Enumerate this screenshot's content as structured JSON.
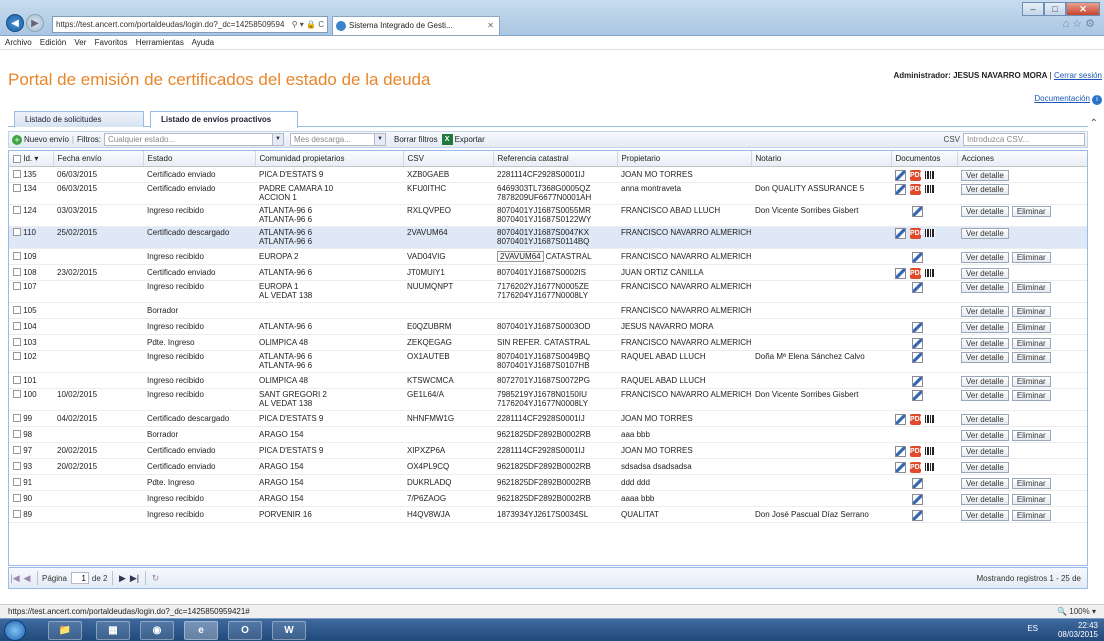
{
  "browser": {
    "url": "https://test.ancert.com/portaldeudas/login.do?_dc=1425850959421",
    "url_shown": "https://test.ancert.com/portaldeudas/login.do?_dc=14258509594",
    "tab_title": "Sistema Integrado de Gesti...",
    "menu": [
      "Archivo",
      "Edición",
      "Ver",
      "Favoritos",
      "Herramientas",
      "Ayuda"
    ]
  },
  "header": {
    "title": "Portal de emisión de certificados del estado de la deuda",
    "admin_label": "Administrador:",
    "admin_name": "JESUS NAVARRO MORA",
    "logout": "Cerrar sesión",
    "documentation": "Documentación"
  },
  "tabs": [
    {
      "label": "Listado de solicitudes",
      "active": false
    },
    {
      "label": "Listado de envíos proactivos",
      "active": true
    }
  ],
  "toolbar": {
    "new_label": "Nuevo envío",
    "filters_label": "Filtros:",
    "status_placeholder": "Cualquier estado...",
    "month_placeholder": "Mes descarga...",
    "clear_filters": "Borrar filtros",
    "export": "Exportar",
    "csv_label": "CSV",
    "csv_placeholder": "Introduzca CSV..."
  },
  "columns": [
    "Id.",
    "Fecha envío",
    "Estado",
    "Comunidad propietarios",
    "CSV",
    "Referencia catastral",
    "Propietario",
    "Notario",
    "Documentos",
    "Acciones"
  ],
  "action_labels": {
    "view": "Ver detalle",
    "delete": "Eliminar"
  },
  "tooltip": "2VAVUM64",
  "rows": [
    {
      "id": "135",
      "fecha": "06/03/2015",
      "estado": "Certificado enviado",
      "comunidad": [
        "PICA D'ESTATS 9"
      ],
      "csv": "XZB0GAEB",
      "ref": [
        "2281114CF2928S0001IJ"
      ],
      "propietario": "JOAN MO TORRES",
      "notario": "",
      "docs": [
        "edit",
        "pdf",
        "bar"
      ],
      "delete": false
    },
    {
      "id": "134",
      "fecha": "06/03/2015",
      "estado": "Certificado enviado",
      "comunidad": [
        "PADRE CAMARA 10",
        "ACCION 1"
      ],
      "csv": "KFU0ITHC",
      "ref": [
        "6469303TL7368G0005QZ",
        "7878209UF6677N0001AH"
      ],
      "propietario": "anna montraveta",
      "notario": "Don QUALITY ASSURANCE 5",
      "docs": [
        "edit",
        "pdf",
        "bar"
      ],
      "delete": false
    },
    {
      "id": "124",
      "fecha": "03/03/2015",
      "estado": "Ingreso recibido",
      "comunidad": [
        "ATLANTA-96 6",
        "ATLANTA-96 6"
      ],
      "csv": "RXLQVPEO",
      "ref": [
        "8070401YJ1687S0055MR",
        "8070401YJ1687S0122WY"
      ],
      "propietario": "FRANCISCO ABAD LLUCH",
      "notario": "Don Vicente Sorribes Gisbert",
      "docs": [
        "edit"
      ],
      "delete": true
    },
    {
      "id": "110",
      "fecha": "25/02/2015",
      "estado": "Certificado descargado",
      "comunidad": [
        "ATLANTA-96 6",
        "ATLANTA-96 6"
      ],
      "csv": "2VAVUM64",
      "ref": [
        "8070401YJ1687S0047KX",
        "8070401YJ1687S0114BQ"
      ],
      "propietario": "FRANCISCO NAVARRO ALMERICH",
      "notario": "",
      "docs": [
        "edit",
        "pdf",
        "bar"
      ],
      "delete": false,
      "selected": true
    },
    {
      "id": "109",
      "fecha": "",
      "estado": "Ingreso recibido",
      "comunidad": [
        "EUROPA 2"
      ],
      "csv": "VAD04VIG",
      "ref": [
        "CATASTRAL"
      ],
      "propietario": "FRANCISCO NAVARRO ALMERICH",
      "notario": "",
      "docs": [
        "edit"
      ],
      "delete": true,
      "tooltip": true
    },
    {
      "id": "108",
      "fecha": "23/02/2015",
      "estado": "Certificado enviado",
      "comunidad": [
        "ATLANTA-96 6"
      ],
      "csv": "JT0MUIY1",
      "ref": [
        "8070401YJ1687S0002IS"
      ],
      "propietario": "JUAN ORTIZ CANILLA",
      "notario": "",
      "docs": [
        "edit",
        "pdf",
        "bar"
      ],
      "delete": false
    },
    {
      "id": "107",
      "fecha": "",
      "estado": "Ingreso recibido",
      "comunidad": [
        "EUROPA 1",
        "AL VEDAT 138"
      ],
      "csv": "NUUMQNPT",
      "ref": [
        "7176202YJ1677N0005ZE",
        "7176204YJ1677N0008LY"
      ],
      "propietario": "FRANCISCO NAVARRO ALMERICH",
      "notario": "",
      "docs": [
        "edit"
      ],
      "delete": true
    },
    {
      "id": "105",
      "fecha": "",
      "estado": "Borrador",
      "comunidad": [
        ""
      ],
      "csv": "",
      "ref": [
        ""
      ],
      "propietario": "FRANCISCO NAVARRO ALMERICH",
      "notario": "",
      "docs": [],
      "delete": true
    },
    {
      "id": "104",
      "fecha": "",
      "estado": "Ingreso recibido",
      "comunidad": [
        "ATLANTA-96 6"
      ],
      "csv": "E0QZUBRM",
      "ref": [
        "8070401YJ1687S0003OD"
      ],
      "propietario": "JESUS NAVARRO MORA",
      "notario": "",
      "docs": [
        "edit"
      ],
      "delete": true
    },
    {
      "id": "103",
      "fecha": "",
      "estado": "Pdte. Ingreso",
      "comunidad": [
        "OLIMPICA 48"
      ],
      "csv": "ZEKQEGAG",
      "ref": [
        "SIN REFER. CATASTRAL"
      ],
      "propietario": "FRANCISCO NAVARRO ALMERICH",
      "notario": "",
      "docs": [
        "edit"
      ],
      "delete": true
    },
    {
      "id": "102",
      "fecha": "",
      "estado": "Ingreso recibido",
      "comunidad": [
        "ATLANTA-96 6",
        "ATLANTA-96 6"
      ],
      "csv": "OX1AUTEB",
      "ref": [
        "8070401YJ1687S0049BQ",
        "8070401YJ1687S0107HB"
      ],
      "propietario": "RAQUEL ABAD LLUCH",
      "notario": "Doña Mª Elena Sánchez Calvo",
      "docs": [
        "edit"
      ],
      "delete": true
    },
    {
      "id": "101",
      "fecha": "",
      "estado": "Ingreso recibido",
      "comunidad": [
        "OLIMPICA 48"
      ],
      "csv": "KTSWCMCA",
      "ref": [
        "8072701YJ1687S0072PG"
      ],
      "propietario": "RAQUEL ABAD LLUCH",
      "notario": "",
      "docs": [
        "edit"
      ],
      "delete": true
    },
    {
      "id": "100",
      "fecha": "10/02/2015",
      "estado": "Ingreso recibido",
      "comunidad": [
        "SANT GREGORI 2",
        "AL VEDAT 138"
      ],
      "csv": "GE1L64/A",
      "ref": [
        "7985219YJ1678N0150IU",
        "7176204YJ1677N0008LY"
      ],
      "propietario": "FRANCISCO NAVARRO ALMERICH",
      "notario": "Don Vicente Sorribes Gisbert",
      "docs": [
        "edit"
      ],
      "delete": true
    },
    {
      "id": "99",
      "fecha": "04/02/2015",
      "estado": "Certificado descargado",
      "comunidad": [
        "PICA D'ESTATS 9"
      ],
      "csv": "NHNFMW1G",
      "ref": [
        "2281114CF2928S0001IJ"
      ],
      "propietario": "JOAN MO TORRES",
      "notario": "",
      "docs": [
        "edit",
        "pdf",
        "bar"
      ],
      "delete": false
    },
    {
      "id": "98",
      "fecha": "",
      "estado": "Borrador",
      "comunidad": [
        "ARAGO 154"
      ],
      "csv": "",
      "ref": [
        "9621825DF2892B0002RB"
      ],
      "propietario": "aaa bbb",
      "notario": "",
      "docs": [],
      "delete": true
    },
    {
      "id": "97",
      "fecha": "20/02/2015",
      "estado": "Certificado enviado",
      "comunidad": [
        "PICA D'ESTATS 9"
      ],
      "csv": "XIPXZP6A",
      "ref": [
        "2281114CF2928S0001IJ"
      ],
      "propietario": "JOAN MO TORRES",
      "notario": "",
      "docs": [
        "edit",
        "pdf",
        "bar"
      ],
      "delete": false
    },
    {
      "id": "93",
      "fecha": "20/02/2015",
      "estado": "Certificado enviado",
      "comunidad": [
        "ARAGO 154"
      ],
      "csv": "OX4PL9CQ",
      "ref": [
        "9621825DF2892B0002RB"
      ],
      "propietario": "sdsadsa dsadsadsa",
      "notario": "",
      "docs": [
        "edit",
        "pdf",
        "bar"
      ],
      "delete": false
    },
    {
      "id": "91",
      "fecha": "",
      "estado": "Pdte. Ingreso",
      "comunidad": [
        "ARAGO 154"
      ],
      "csv": "DUKRLADQ",
      "ref": [
        "9621825DF2892B0002RB"
      ],
      "propietario": "ddd ddd",
      "notario": "",
      "docs": [
        "edit"
      ],
      "delete": true
    },
    {
      "id": "90",
      "fecha": "",
      "estado": "Ingreso recibido",
      "comunidad": [
        "ARAGO 154"
      ],
      "csv": "7/P6ZAOG",
      "ref": [
        "9621825DF2892B0002RB"
      ],
      "propietario": "aaaa bbb",
      "notario": "",
      "docs": [
        "edit"
      ],
      "delete": true
    },
    {
      "id": "89",
      "fecha": "",
      "estado": "Ingreso recibido",
      "comunidad": [
        "PORVENIR 16"
      ],
      "csv": "H4QV8WJA",
      "ref": [
        "1873934YJ2617S0034SL"
      ],
      "propietario": "QUALITAT",
      "notario": "Don José Pascual Díaz Serrano",
      "docs": [
        "edit"
      ],
      "delete": true
    }
  ],
  "pager": {
    "page_label": "Página",
    "page": "1",
    "of": "de 2",
    "display": "Mostrando registros 1 - 25 de"
  },
  "status": {
    "url": "https://test.ancert.com/portaldeudas/login.do?_dc=1425850959421#",
    "zoom": "100%"
  },
  "tray": {
    "lang": "ES",
    "time": "22:43",
    "date": "08/03/2015"
  }
}
